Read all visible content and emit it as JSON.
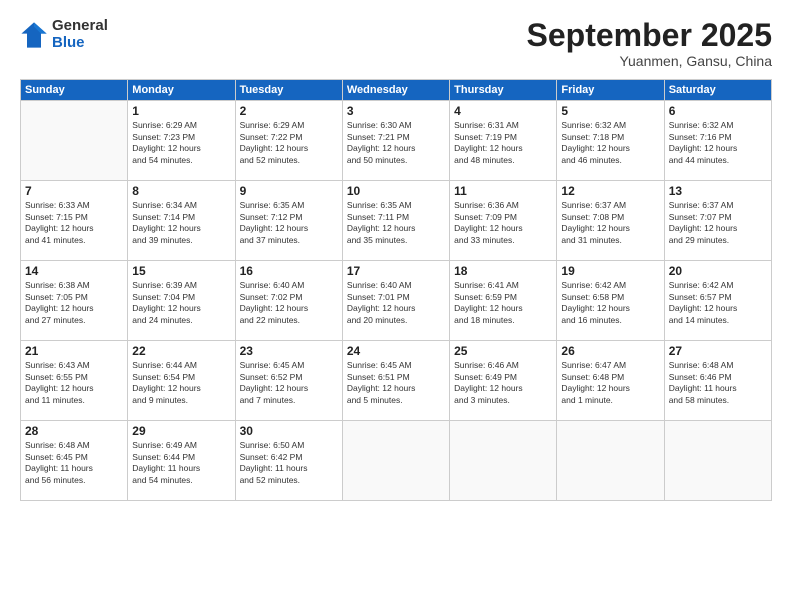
{
  "header": {
    "logo_general": "General",
    "logo_blue": "Blue",
    "month_title": "September 2025",
    "location": "Yuanmen, Gansu, China"
  },
  "days_of_week": [
    "Sunday",
    "Monday",
    "Tuesday",
    "Wednesday",
    "Thursday",
    "Friday",
    "Saturday"
  ],
  "weeks": [
    [
      {
        "day": "",
        "info": ""
      },
      {
        "day": "1",
        "info": "Sunrise: 6:29 AM\nSunset: 7:23 PM\nDaylight: 12 hours\nand 54 minutes."
      },
      {
        "day": "2",
        "info": "Sunrise: 6:29 AM\nSunset: 7:22 PM\nDaylight: 12 hours\nand 52 minutes."
      },
      {
        "day": "3",
        "info": "Sunrise: 6:30 AM\nSunset: 7:21 PM\nDaylight: 12 hours\nand 50 minutes."
      },
      {
        "day": "4",
        "info": "Sunrise: 6:31 AM\nSunset: 7:19 PM\nDaylight: 12 hours\nand 48 minutes."
      },
      {
        "day": "5",
        "info": "Sunrise: 6:32 AM\nSunset: 7:18 PM\nDaylight: 12 hours\nand 46 minutes."
      },
      {
        "day": "6",
        "info": "Sunrise: 6:32 AM\nSunset: 7:16 PM\nDaylight: 12 hours\nand 44 minutes."
      }
    ],
    [
      {
        "day": "7",
        "info": "Sunrise: 6:33 AM\nSunset: 7:15 PM\nDaylight: 12 hours\nand 41 minutes."
      },
      {
        "day": "8",
        "info": "Sunrise: 6:34 AM\nSunset: 7:14 PM\nDaylight: 12 hours\nand 39 minutes."
      },
      {
        "day": "9",
        "info": "Sunrise: 6:35 AM\nSunset: 7:12 PM\nDaylight: 12 hours\nand 37 minutes."
      },
      {
        "day": "10",
        "info": "Sunrise: 6:35 AM\nSunset: 7:11 PM\nDaylight: 12 hours\nand 35 minutes."
      },
      {
        "day": "11",
        "info": "Sunrise: 6:36 AM\nSunset: 7:09 PM\nDaylight: 12 hours\nand 33 minutes."
      },
      {
        "day": "12",
        "info": "Sunrise: 6:37 AM\nSunset: 7:08 PM\nDaylight: 12 hours\nand 31 minutes."
      },
      {
        "day": "13",
        "info": "Sunrise: 6:37 AM\nSunset: 7:07 PM\nDaylight: 12 hours\nand 29 minutes."
      }
    ],
    [
      {
        "day": "14",
        "info": "Sunrise: 6:38 AM\nSunset: 7:05 PM\nDaylight: 12 hours\nand 27 minutes."
      },
      {
        "day": "15",
        "info": "Sunrise: 6:39 AM\nSunset: 7:04 PM\nDaylight: 12 hours\nand 24 minutes."
      },
      {
        "day": "16",
        "info": "Sunrise: 6:40 AM\nSunset: 7:02 PM\nDaylight: 12 hours\nand 22 minutes."
      },
      {
        "day": "17",
        "info": "Sunrise: 6:40 AM\nSunset: 7:01 PM\nDaylight: 12 hours\nand 20 minutes."
      },
      {
        "day": "18",
        "info": "Sunrise: 6:41 AM\nSunset: 6:59 PM\nDaylight: 12 hours\nand 18 minutes."
      },
      {
        "day": "19",
        "info": "Sunrise: 6:42 AM\nSunset: 6:58 PM\nDaylight: 12 hours\nand 16 minutes."
      },
      {
        "day": "20",
        "info": "Sunrise: 6:42 AM\nSunset: 6:57 PM\nDaylight: 12 hours\nand 14 minutes."
      }
    ],
    [
      {
        "day": "21",
        "info": "Sunrise: 6:43 AM\nSunset: 6:55 PM\nDaylight: 12 hours\nand 11 minutes."
      },
      {
        "day": "22",
        "info": "Sunrise: 6:44 AM\nSunset: 6:54 PM\nDaylight: 12 hours\nand 9 minutes."
      },
      {
        "day": "23",
        "info": "Sunrise: 6:45 AM\nSunset: 6:52 PM\nDaylight: 12 hours\nand 7 minutes."
      },
      {
        "day": "24",
        "info": "Sunrise: 6:45 AM\nSunset: 6:51 PM\nDaylight: 12 hours\nand 5 minutes."
      },
      {
        "day": "25",
        "info": "Sunrise: 6:46 AM\nSunset: 6:49 PM\nDaylight: 12 hours\nand 3 minutes."
      },
      {
        "day": "26",
        "info": "Sunrise: 6:47 AM\nSunset: 6:48 PM\nDaylight: 12 hours\nand 1 minute."
      },
      {
        "day": "27",
        "info": "Sunrise: 6:48 AM\nSunset: 6:46 PM\nDaylight: 11 hours\nand 58 minutes."
      }
    ],
    [
      {
        "day": "28",
        "info": "Sunrise: 6:48 AM\nSunset: 6:45 PM\nDaylight: 11 hours\nand 56 minutes."
      },
      {
        "day": "29",
        "info": "Sunrise: 6:49 AM\nSunset: 6:44 PM\nDaylight: 11 hours\nand 54 minutes."
      },
      {
        "day": "30",
        "info": "Sunrise: 6:50 AM\nSunset: 6:42 PM\nDaylight: 11 hours\nand 52 minutes."
      },
      {
        "day": "",
        "info": ""
      },
      {
        "day": "",
        "info": ""
      },
      {
        "day": "",
        "info": ""
      },
      {
        "day": "",
        "info": ""
      }
    ]
  ]
}
